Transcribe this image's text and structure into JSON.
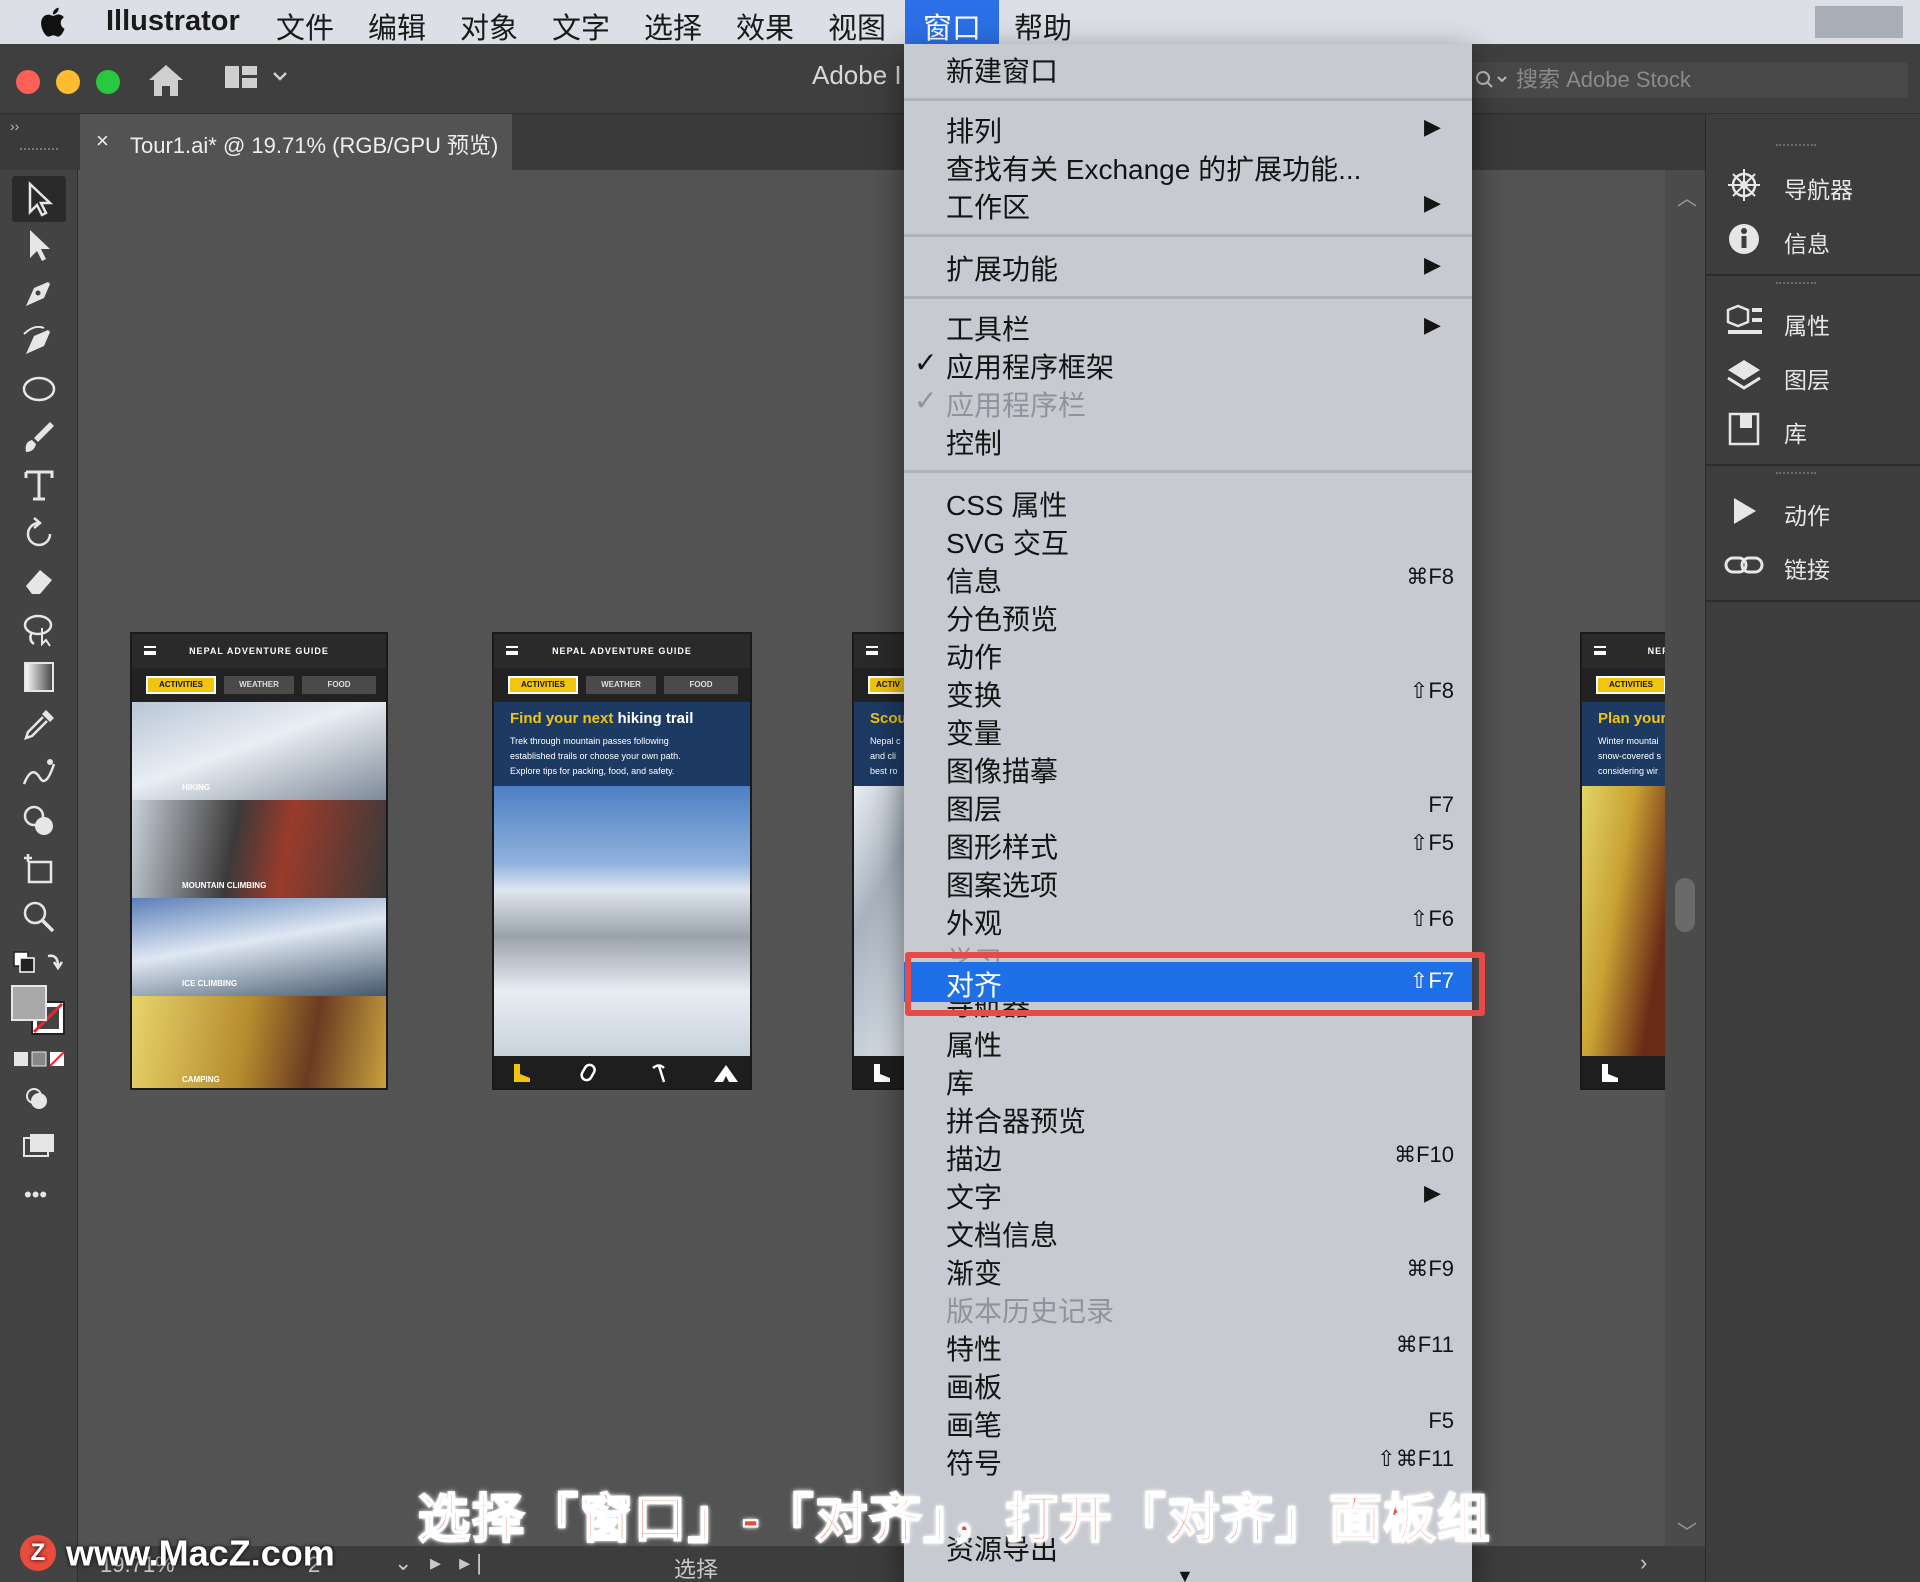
{
  "menubar": {
    "app_name": "Illustrator",
    "items": [
      "文件",
      "编辑",
      "对象",
      "文字",
      "选择",
      "效果",
      "视图",
      "窗口",
      "帮助"
    ],
    "active_item": "窗口"
  },
  "app": {
    "title": "Adobe I",
    "search_placeholder": "搜索 Adobe Stock",
    "tab_close": "×",
    "doc_tab": "Tour1.ai* @ 19.71% (RGB/GPU 预览)",
    "collapse_left": "››",
    "collapse_right": "‹‹"
  },
  "right_panel": {
    "items": [
      {
        "label": "导航器",
        "icon": "navigator-icon"
      },
      {
        "label": "信息",
        "icon": "info-icon"
      },
      {
        "label": "属性",
        "icon": "properties-icon"
      },
      {
        "label": "图层",
        "icon": "layers-icon"
      },
      {
        "label": "库",
        "icon": "libraries-icon"
      },
      {
        "label": "动作",
        "icon": "actions-icon"
      },
      {
        "label": "链接",
        "icon": "links-icon"
      }
    ]
  },
  "toolbar": {
    "tools": [
      "selection-tool",
      "direct-selection-tool",
      "pen-tool",
      "curvature-tool",
      "ellipse-tool",
      "paintbrush-tool",
      "type-tool",
      "rotate-tool",
      "eraser-tool",
      "lasso-tool",
      "gradient-tool",
      "eyedropper-tool",
      "blend-tool",
      "shape-builder-tool",
      "artboard-tool",
      "zoom-tool"
    ],
    "more": "•••"
  },
  "artboards": {
    "header": "NEPAL ADVENTURE GUIDE",
    "tabs": [
      "ACTIVITIES",
      "WEATHER",
      "FOOD"
    ],
    "tab_partial": "ACTIV",
    "strips": [
      "HIKING",
      "MOUNTAIN CLIMBING",
      "ICE CLIMBING",
      "CAMPING"
    ],
    "hero_title_a": "Find your next ",
    "hero_title_b": "hiking trail",
    "hero_body": "Trek through mountain passes following\nestablished trails or choose your own path.\nExplore tips for packing, food, and safety.",
    "third_title": "Scou",
    "third_body": "Nepal c\nand cli\nbest ro",
    "fourth_header": "NEPA",
    "fourth_title": "Plan your",
    "fourth_body": "Winter mountai\nsnow-covered s\nconsidering wir"
  },
  "window_menu": {
    "items": [
      {
        "label": "新建窗口"
      },
      {
        "label": "排列",
        "submenu": "▶"
      },
      {
        "label": "查找有关 Exchange 的扩展功能..."
      },
      {
        "label": "工作区",
        "submenu": "▶"
      },
      {
        "label": "扩展功能",
        "submenu": "▶"
      },
      {
        "label": "工具栏",
        "submenu": "▶"
      },
      {
        "label": "应用程序框架",
        "check": "✓"
      },
      {
        "label": "应用程序栏",
        "check": "✓"
      },
      {
        "label": "控制"
      },
      {
        "label": "CSS 属性"
      },
      {
        "label": "SVG 交互"
      },
      {
        "label": "信息",
        "shortcut": "⌘F8"
      },
      {
        "label": "分色预览"
      },
      {
        "label": "动作"
      },
      {
        "label": "变换",
        "shortcut": "⇧F8"
      },
      {
        "label": "变量"
      },
      {
        "label": "图像描摹"
      },
      {
        "label": "图层",
        "shortcut": "F7"
      },
      {
        "label": "图形样式",
        "shortcut": "⇧F5"
      },
      {
        "label": "图案选项"
      },
      {
        "label": "外观",
        "shortcut": "⇧F6"
      },
      {
        "label": "学习"
      },
      {
        "label": "对齐",
        "shortcut": "⇧F7"
      },
      {
        "label": "导航器"
      },
      {
        "label": "属性"
      },
      {
        "label": "库"
      },
      {
        "label": "拼合器预览"
      },
      {
        "label": "描边",
        "shortcut": "⌘F10"
      },
      {
        "label": "文字",
        "submenu": "▶"
      },
      {
        "label": "文档信息"
      },
      {
        "label": "渐变",
        "shortcut": "⌘F9"
      },
      {
        "label": "版本历史记录"
      },
      {
        "label": "特性",
        "shortcut": "⌘F11"
      },
      {
        "label": "画板"
      },
      {
        "label": "画笔",
        "shortcut": "F5"
      },
      {
        "label": "符号",
        "shortcut": "⇧⌘F11"
      },
      {
        "label": "资源导出"
      }
    ],
    "highlighted": "对齐",
    "more_indicator": "▼"
  },
  "status_bar": {
    "zoom": "19.71%",
    "page": "2",
    "state": "选择"
  },
  "overlay": {
    "caption": "选择「窗口」-「对齐」，打开「对齐」面板组",
    "watermark": "www.MacZ.com",
    "watermark_logo": "Z"
  },
  "colors": {
    "menu_highlight": "#1f6fe6",
    "annotation_red": "#e84a44",
    "accent_yellow": "#f1c40f"
  }
}
